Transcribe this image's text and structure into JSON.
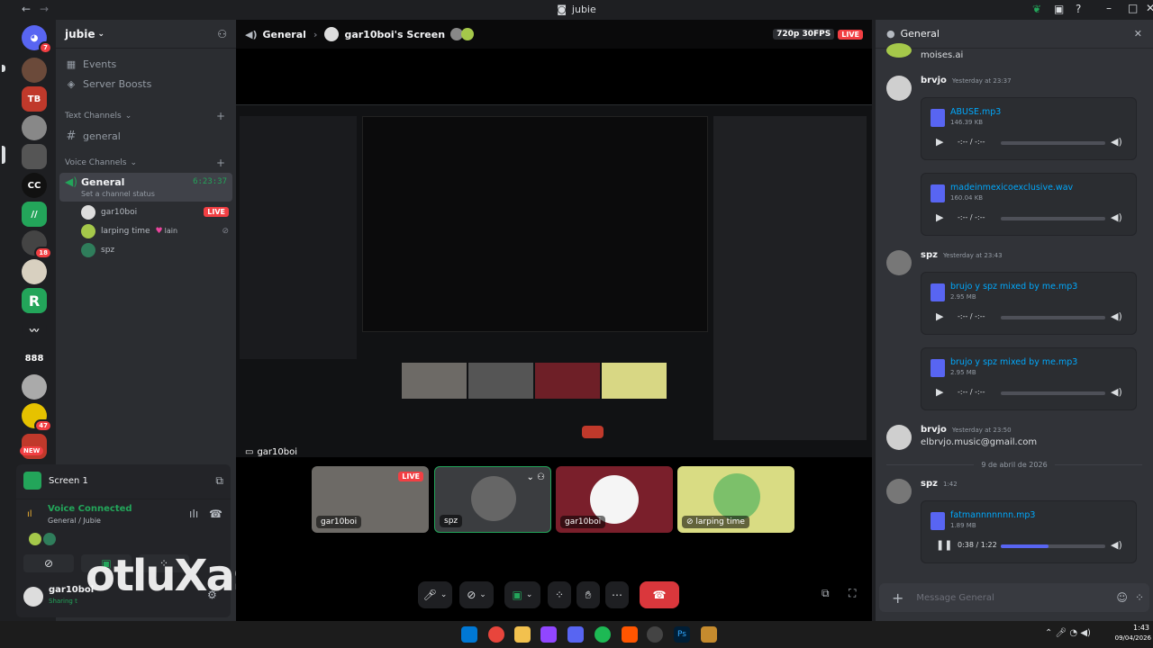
{
  "titlebar": {
    "title": "jubie"
  },
  "rail": {
    "badges": {
      "home": "7",
      "s8": "18",
      "s14": "47"
    },
    "new_label": "NEW"
  },
  "sidebar": {
    "guild_name": "jubie",
    "items": [
      {
        "label": "Events"
      },
      {
        "label": "Server Boosts"
      }
    ],
    "text_category": "Text Channels",
    "text_channels": [
      {
        "label": "general"
      }
    ],
    "voice_category": "Voice Channels",
    "voice_channel": {
      "label": "General",
      "timer": "6:23:37",
      "status": "Set a channel status"
    },
    "voice_users": [
      {
        "name": "gar10boi",
        "badge": "LIVE"
      },
      {
        "name": "larping time",
        "tag": "lain"
      },
      {
        "name": "spz"
      }
    ]
  },
  "voice_panel": {
    "screen_label": "Screen 1",
    "status": "Voice Connected",
    "location": "General / Jubie",
    "user": "gar10boi",
    "user_sub": "Sharing t",
    "watermark": "otluXasi"
  },
  "main": {
    "channel": "General",
    "screen": "gar10boi's Screen",
    "quality": "720p 30FPS",
    "live": "LIVE",
    "stream_owner": "gar10boi",
    "tiles": [
      {
        "label": "gar10boi",
        "live": "LIVE"
      },
      {
        "label": "spz"
      },
      {
        "label": "gar10boi"
      },
      {
        "label": "larping time"
      }
    ]
  },
  "chat": {
    "header": "General",
    "top_snippet": "moises.ai",
    "messages": [
      {
        "user": "brvjo",
        "time": "Yesterday at 23:37",
        "files": [
          {
            "name": "ABUSE.mp3",
            "size": "146.39 KB",
            "time": "-:-- / -:--",
            "progress": 0
          },
          {
            "name": "madeinmexicoexclusive.wav",
            "size": "160.04 KB",
            "time": "-:-- / -:--",
            "progress": 0
          }
        ]
      },
      {
        "user": "spz",
        "time": "Yesterday at 23:43",
        "files": [
          {
            "name": "brujo y spz mixed by me.mp3",
            "size": "2.95 MB",
            "time": "-:-- / -:--",
            "progress": 0
          },
          {
            "name": "brujo y spz mixed by me.mp3",
            "size": "2.95 MB",
            "time": "-:-- / -:--",
            "progress": 0
          }
        ]
      },
      {
        "user": "brvjo",
        "time": "Yesterday at 23:50",
        "text": "elbrvjo.music@gmail.com"
      },
      {
        "divider": "9 de abril de 2026"
      },
      {
        "user": "spz",
        "time": "1:42",
        "files": [
          {
            "name": "fatmannnnnnn.mp3",
            "size": "1.89 MB",
            "time": "0:38 / 1:22",
            "progress": 0.46
          }
        ]
      }
    ],
    "input_placeholder": "Message General"
  },
  "taskbar": {
    "clock": "1:43",
    "date": "09/04/2026"
  },
  "colors": {
    "accent": "#5865f2",
    "live": "#f23f43",
    "green": "#23a55a",
    "link": "#00a8fc"
  }
}
